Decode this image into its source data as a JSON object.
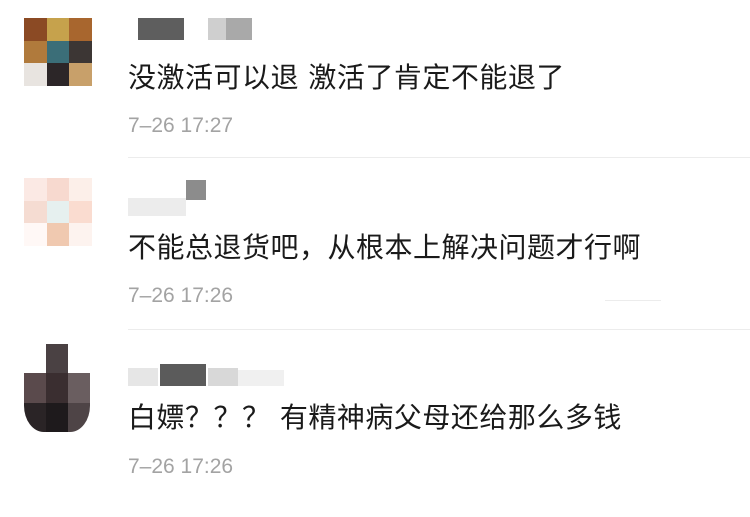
{
  "comments": [
    {
      "content": "没激活可以退 激活了肯定不能退了",
      "time": "7–26 17:27",
      "avatar_colors": [
        "#8b4a24",
        "#c6a24c",
        "#a8662e",
        "#b07a3c",
        "#3b6e78",
        "#3c3634",
        "#e8e4e0",
        "#2c2628",
        "#c8a06a"
      ]
    },
    {
      "content": "不能总退货吧，从根本上解决问题才行啊",
      "time": "7–26 17:26",
      "avatar_colors": [
        "#fbe9e4",
        "#f7d9cf",
        "#fcefe9",
        "#f5dcd2",
        "#e6f0ef",
        "#fadcd0",
        "#fff8f6",
        "#f0c9b0",
        "#fdf3ef"
      ]
    },
    {
      "content": "白嫖？？？ 有精神病父母还给那么多钱",
      "time": "7–26 17:26",
      "avatar_colors": [
        "#ffffff",
        "#4a4143",
        "#ffffff",
        "#5a4a4c",
        "#3a2e30",
        "#6a5e60",
        "#2a2426",
        "#1e1a1c",
        "#4e4446"
      ]
    }
  ]
}
